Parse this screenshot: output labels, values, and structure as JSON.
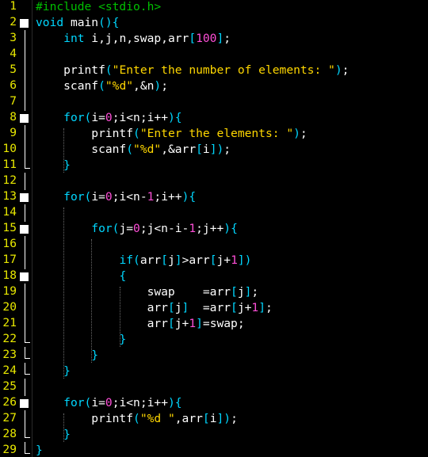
{
  "editor": {
    "language": "C",
    "colors": {
      "background": "#000000",
      "line_number": "#e8e800",
      "keyword": "#00d7ff",
      "string": "#ffd700",
      "number": "#ff4fd8",
      "preprocessor": "#00c000",
      "text": "#ffffff",
      "fold_marker": "#ffffff"
    },
    "lines": [
      {
        "n": "1",
        "fold": "",
        "tokens": [
          {
            "t": "#include <stdio.h>",
            "c": "pp"
          }
        ]
      },
      {
        "n": "2",
        "fold": "box",
        "tokens": [
          {
            "t": "void",
            "c": "kw"
          },
          {
            "t": " main",
            "c": "id"
          },
          {
            "t": "(){",
            "c": "br"
          }
        ]
      },
      {
        "n": "3",
        "fold": "pipe",
        "tokens": [
          {
            "t": "    ",
            "c": "id"
          },
          {
            "t": "int",
            "c": "kw"
          },
          {
            "t": " i,j,n,swap,arr",
            "c": "id"
          },
          {
            "t": "[",
            "c": "br"
          },
          {
            "t": "100",
            "c": "num"
          },
          {
            "t": "]",
            "c": "br"
          },
          {
            "t": ";",
            "c": "id"
          }
        ]
      },
      {
        "n": "4",
        "fold": "pipe",
        "tokens": []
      },
      {
        "n": "5",
        "fold": "pipe",
        "tokens": [
          {
            "t": "    printf",
            "c": "id"
          },
          {
            "t": "(",
            "c": "br"
          },
          {
            "t": "\"Enter the number of elements: \"",
            "c": "str"
          },
          {
            "t": ")",
            "c": "br"
          },
          {
            "t": ";",
            "c": "id"
          }
        ]
      },
      {
        "n": "6",
        "fold": "pipe",
        "tokens": [
          {
            "t": "    scanf",
            "c": "id"
          },
          {
            "t": "(",
            "c": "br"
          },
          {
            "t": "\"%d\"",
            "c": "str"
          },
          {
            "t": ",&n",
            "c": "id"
          },
          {
            "t": ")",
            "c": "br"
          },
          {
            "t": ";",
            "c": "id"
          }
        ]
      },
      {
        "n": "7",
        "fold": "pipe",
        "tokens": []
      },
      {
        "n": "8",
        "fold": "box",
        "tokens": [
          {
            "t": "    ",
            "c": "id"
          },
          {
            "t": "for",
            "c": "kw"
          },
          {
            "t": "(",
            "c": "br"
          },
          {
            "t": "i=",
            "c": "id"
          },
          {
            "t": "0",
            "c": "num"
          },
          {
            "t": ";i<n;i++",
            "c": "id"
          },
          {
            "t": "){",
            "c": "br"
          }
        ]
      },
      {
        "n": "9",
        "fold": "pipe",
        "tokens": [
          {
            "t": "        printf",
            "c": "id"
          },
          {
            "t": "(",
            "c": "br"
          },
          {
            "t": "\"Enter the elements: \"",
            "c": "str"
          },
          {
            "t": ")",
            "c": "br"
          },
          {
            "t": ";",
            "c": "id"
          }
        ]
      },
      {
        "n": "10",
        "fold": "pipe",
        "tokens": [
          {
            "t": "        scanf",
            "c": "id"
          },
          {
            "t": "(",
            "c": "br"
          },
          {
            "t": "\"%d\"",
            "c": "str"
          },
          {
            "t": ",&arr",
            "c": "id"
          },
          {
            "t": "[",
            "c": "br"
          },
          {
            "t": "i",
            "c": "id"
          },
          {
            "t": "])",
            "c": "br"
          },
          {
            "t": ";",
            "c": "id"
          }
        ]
      },
      {
        "n": "11",
        "fold": "end",
        "tokens": [
          {
            "t": "    ",
            "c": "id"
          },
          {
            "t": "}",
            "c": "br"
          }
        ]
      },
      {
        "n": "12",
        "fold": "pipe",
        "tokens": []
      },
      {
        "n": "13",
        "fold": "box",
        "tokens": [
          {
            "t": "    ",
            "c": "id"
          },
          {
            "t": "for",
            "c": "kw"
          },
          {
            "t": "(",
            "c": "br"
          },
          {
            "t": "i=",
            "c": "id"
          },
          {
            "t": "0",
            "c": "num"
          },
          {
            "t": ";i<n-",
            "c": "id"
          },
          {
            "t": "1",
            "c": "num"
          },
          {
            "t": ";i++",
            "c": "id"
          },
          {
            "t": "){",
            "c": "br"
          }
        ]
      },
      {
        "n": "14",
        "fold": "pipe",
        "tokens": []
      },
      {
        "n": "15",
        "fold": "box",
        "tokens": [
          {
            "t": "        ",
            "c": "id"
          },
          {
            "t": "for",
            "c": "kw"
          },
          {
            "t": "(",
            "c": "br"
          },
          {
            "t": "j=",
            "c": "id"
          },
          {
            "t": "0",
            "c": "num"
          },
          {
            "t": ";j<n-i-",
            "c": "id"
          },
          {
            "t": "1",
            "c": "num"
          },
          {
            "t": ";j++",
            "c": "id"
          },
          {
            "t": "){",
            "c": "br"
          }
        ]
      },
      {
        "n": "16",
        "fold": "pipe",
        "tokens": []
      },
      {
        "n": "17",
        "fold": "pipe",
        "tokens": [
          {
            "t": "            ",
            "c": "id"
          },
          {
            "t": "if",
            "c": "kw"
          },
          {
            "t": "(",
            "c": "br"
          },
          {
            "t": "arr",
            "c": "id"
          },
          {
            "t": "[",
            "c": "br"
          },
          {
            "t": "j",
            "c": "id"
          },
          {
            "t": "]",
            "c": "br"
          },
          {
            "t": ">arr",
            "c": "id"
          },
          {
            "t": "[",
            "c": "br"
          },
          {
            "t": "j+",
            "c": "id"
          },
          {
            "t": "1",
            "c": "num"
          },
          {
            "t": "])",
            "c": "br"
          }
        ]
      },
      {
        "n": "18",
        "fold": "box",
        "tokens": [
          {
            "t": "            ",
            "c": "id"
          },
          {
            "t": "{",
            "c": "br"
          }
        ]
      },
      {
        "n": "19",
        "fold": "pipe",
        "tokens": [
          {
            "t": "                swap    =arr",
            "c": "id"
          },
          {
            "t": "[",
            "c": "br"
          },
          {
            "t": "j",
            "c": "id"
          },
          {
            "t": "]",
            "c": "br"
          },
          {
            "t": ";",
            "c": "id"
          }
        ]
      },
      {
        "n": "20",
        "fold": "pipe",
        "tokens": [
          {
            "t": "                arr",
            "c": "id"
          },
          {
            "t": "[",
            "c": "br"
          },
          {
            "t": "j",
            "c": "id"
          },
          {
            "t": "]",
            "c": "br"
          },
          {
            "t": "  =arr",
            "c": "id"
          },
          {
            "t": "[",
            "c": "br"
          },
          {
            "t": "j+",
            "c": "id"
          },
          {
            "t": "1",
            "c": "num"
          },
          {
            "t": "]",
            "c": "br"
          },
          {
            "t": ";",
            "c": "id"
          }
        ]
      },
      {
        "n": "21",
        "fold": "pipe",
        "tokens": [
          {
            "t": "                arr",
            "c": "id"
          },
          {
            "t": "[",
            "c": "br"
          },
          {
            "t": "j+",
            "c": "id"
          },
          {
            "t": "1",
            "c": "num"
          },
          {
            "t": "]",
            "c": "br"
          },
          {
            "t": "=swap;",
            "c": "id"
          }
        ]
      },
      {
        "n": "22",
        "fold": "end",
        "tokens": [
          {
            "t": "            ",
            "c": "id"
          },
          {
            "t": "}",
            "c": "br"
          }
        ]
      },
      {
        "n": "23",
        "fold": "end",
        "tokens": [
          {
            "t": "        ",
            "c": "id"
          },
          {
            "t": "}",
            "c": "br"
          }
        ]
      },
      {
        "n": "24",
        "fold": "end",
        "tokens": [
          {
            "t": "    ",
            "c": "id"
          },
          {
            "t": "}",
            "c": "br"
          }
        ]
      },
      {
        "n": "25",
        "fold": "pipe",
        "tokens": []
      },
      {
        "n": "26",
        "fold": "box",
        "tokens": [
          {
            "t": "    ",
            "c": "id"
          },
          {
            "t": "for",
            "c": "kw"
          },
          {
            "t": "(",
            "c": "br"
          },
          {
            "t": "i=",
            "c": "id"
          },
          {
            "t": "0",
            "c": "num"
          },
          {
            "t": ";i<n;i++",
            "c": "id"
          },
          {
            "t": "){",
            "c": "br"
          }
        ]
      },
      {
        "n": "27",
        "fold": "pipe",
        "tokens": [
          {
            "t": "        printf",
            "c": "id"
          },
          {
            "t": "(",
            "c": "br"
          },
          {
            "t": "\"%d \"",
            "c": "str"
          },
          {
            "t": ",arr",
            "c": "id"
          },
          {
            "t": "[",
            "c": "br"
          },
          {
            "t": "i",
            "c": "id"
          },
          {
            "t": "])",
            "c": "br"
          },
          {
            "t": ";",
            "c": "id"
          }
        ]
      },
      {
        "n": "28",
        "fold": "end",
        "tokens": [
          {
            "t": "    ",
            "c": "id"
          },
          {
            "t": "}",
            "c": "br"
          }
        ]
      },
      {
        "n": "29",
        "fold": "end",
        "tokens": [
          {
            "t": "}",
            "c": "br"
          }
        ]
      }
    ]
  }
}
